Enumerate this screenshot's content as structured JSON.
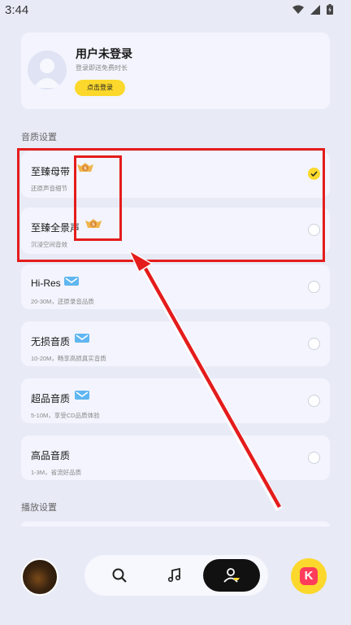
{
  "status_bar": {
    "time": "3:44"
  },
  "user": {
    "name": "用户未登录",
    "hint": "登录即送免费时长",
    "login_label": "点击登录"
  },
  "sections": {
    "quality_title": "音质设置",
    "playback_title": "播放设置"
  },
  "quality_options": [
    {
      "name": "至臻母带",
      "desc": "还原声音细节",
      "badge": "svip",
      "selected": true
    },
    {
      "name": "至臻全景声",
      "desc": "沉浸空间音效",
      "badge": "svip",
      "selected": false
    },
    {
      "name": "Hi-Res",
      "desc": "20-30M，还原录音品质",
      "badge": "vip",
      "selected": false
    },
    {
      "name": "无损音质",
      "desc": "10-20M，畅享高损真实音质",
      "badge": "vip",
      "selected": false
    },
    {
      "name": "超品音质",
      "desc": "5-10M，享受CD品质体验",
      "badge": "vip",
      "selected": false
    },
    {
      "name": "高品音质",
      "desc": "1-3M，省流好品质",
      "badge": "",
      "selected": false
    }
  ],
  "colors": {
    "accent_yellow": "#fbd82b",
    "annotation_red": "#e41c1c",
    "background": "#e8eaf6",
    "card": "#f3f4fd"
  },
  "nav": {
    "icons": [
      "search-icon",
      "music-note-icon",
      "profile-icon"
    ],
    "active": "profile-icon"
  }
}
